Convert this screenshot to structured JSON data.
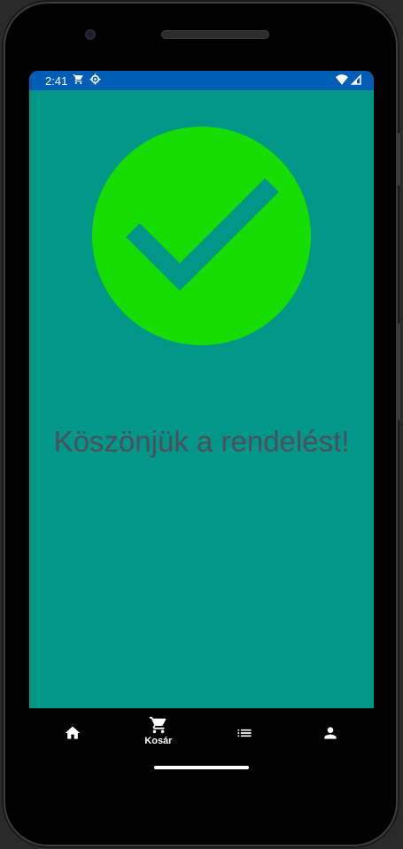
{
  "status_bar": {
    "time": "2:41",
    "left_icons": [
      "cart-icon",
      "settings-icon"
    ],
    "right_icons": [
      "wifi-icon",
      "signal-icon"
    ],
    "background": "#005cb5"
  },
  "main": {
    "background": "#009688",
    "success_icon": "check-circle-icon",
    "success_color": "#16dd00",
    "check_color": "#009688",
    "message": "Köszönjük a rendelést!",
    "message_color": "#4f4f5c"
  },
  "bottom_nav": {
    "items": [
      {
        "icon": "home-icon",
        "label": "",
        "active": false
      },
      {
        "icon": "cart-icon",
        "label": "Kosár",
        "active": true
      },
      {
        "icon": "list-icon",
        "label": "",
        "active": false
      },
      {
        "icon": "person-icon",
        "label": "",
        "active": false
      }
    ]
  }
}
